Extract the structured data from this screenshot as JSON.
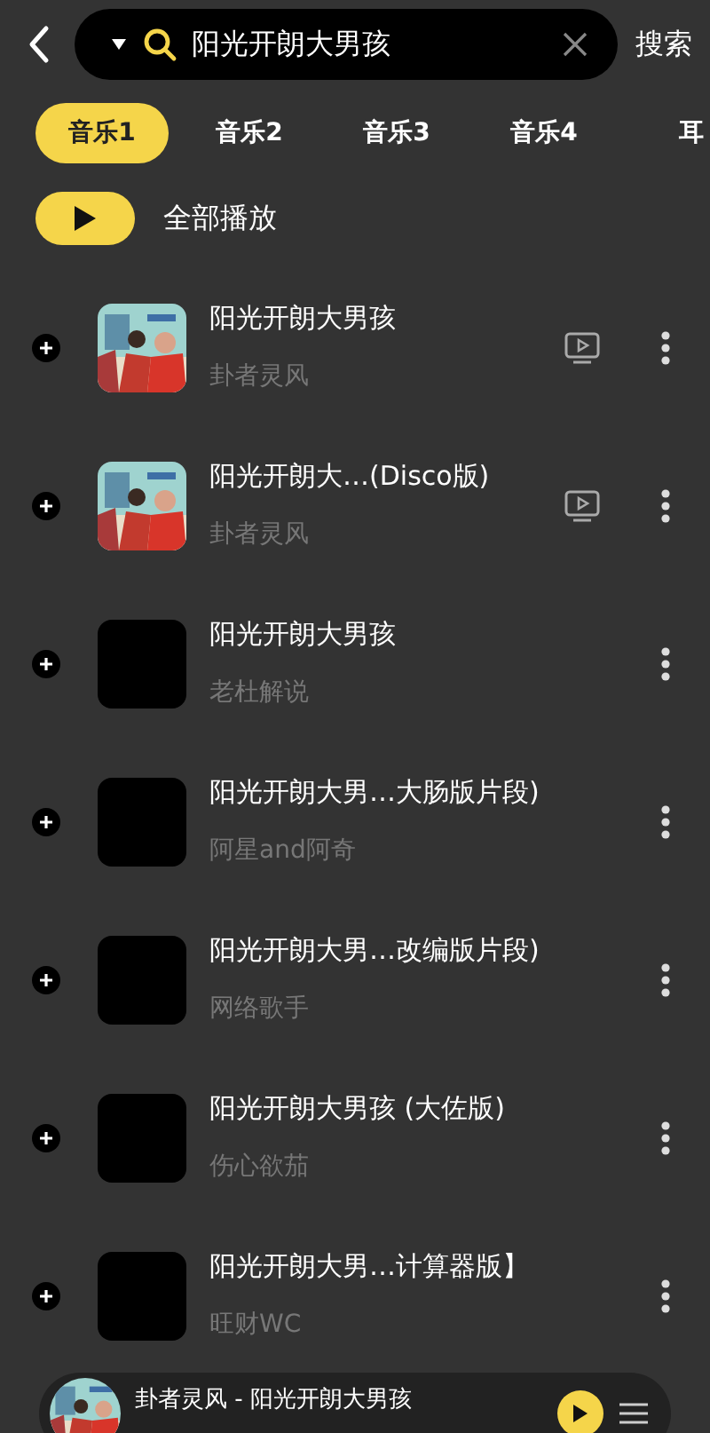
{
  "search": {
    "value": "阳光开朗大男孩",
    "submit": "搜索"
  },
  "tabs": [
    {
      "label": "音乐1",
      "selected": true
    },
    {
      "label": "音乐2",
      "selected": false
    },
    {
      "label": "音乐3",
      "selected": false
    },
    {
      "label": "音乐4",
      "selected": false
    },
    {
      "label": "耳",
      "selected": false
    }
  ],
  "play_all": "全部播放",
  "songs": [
    {
      "title": "阳光开朗大男孩",
      "artist": "卦者灵风",
      "video": true
    },
    {
      "title": "阳光开朗大…(Disco版)",
      "artist": "卦者灵风",
      "video": true
    },
    {
      "title": "阳光开朗大男孩",
      "artist": "老杜解说",
      "cover": {
        "kind": "blank"
      },
      "video": false
    },
    {
      "title": "阳光开朗大男…大肠版片段)",
      "artist": "阿星and阿奇",
      "cover": {
        "kind": "blank"
      },
      "video": false
    },
    {
      "title": "阳光开朗大男…改编版片段)",
      "artist": "网络歌手",
      "cover": {
        "kind": "blank"
      },
      "video": false
    },
    {
      "title": "阳光开朗大男孩 (大佐版)",
      "artist": "伤心欲茄",
      "cover": {
        "kind": "blank"
      },
      "video": false
    },
    {
      "title": "阳光开朗大男…计算器版】",
      "artist": "旺财WC",
      "cover": {
        "kind": "blank"
      },
      "video": false
    }
  ],
  "now_playing": {
    "text": "卦者灵风 - 阳光开朗大男孩"
  }
}
